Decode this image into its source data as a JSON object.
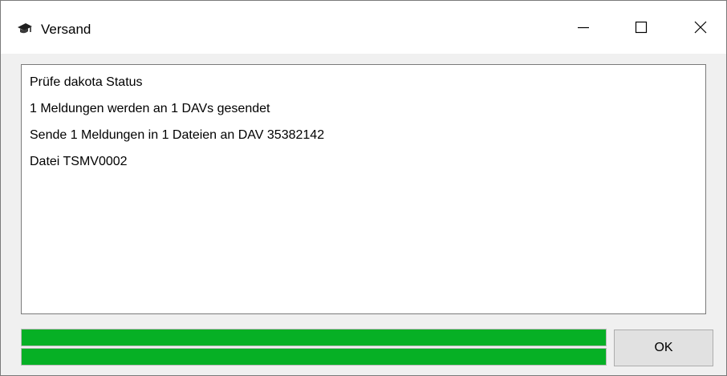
{
  "window": {
    "title": "Versand",
    "icon": "graduation-cap-icon",
    "controls": [
      "minimize-icon",
      "maximize-icon",
      "close-icon"
    ]
  },
  "log": {
    "lines": [
      "Prüfe dakota Status",
      "1 Meldungen werden an 1 DAVs gesendet",
      "Sende 1 Meldungen in 1 Dateien an DAV 35382142",
      "Datei TSMV0002"
    ]
  },
  "progress": {
    "bars": [
      {
        "name": "progress-bar-top",
        "percent": 100
      },
      {
        "name": "progress-bar-bottom",
        "percent": 100
      }
    ],
    "color": "#06b025"
  },
  "buttons": {
    "ok_label": "OK"
  }
}
